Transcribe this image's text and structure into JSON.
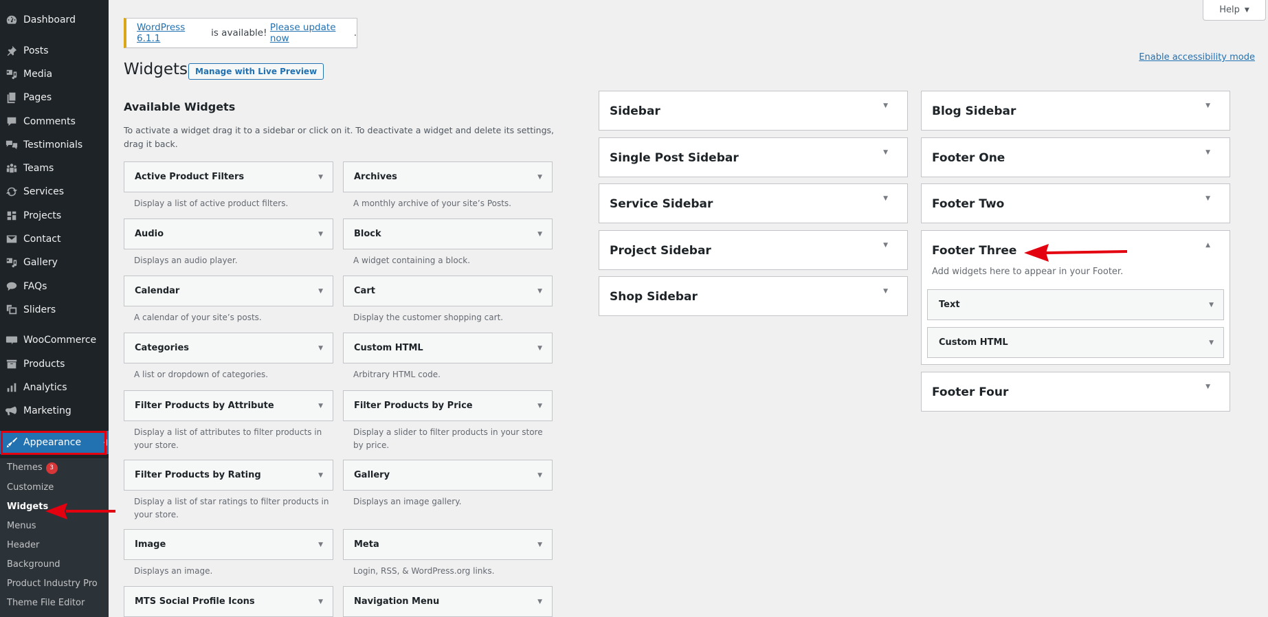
{
  "sidebar": {
    "items": [
      {
        "label": "Dashboard",
        "icon": "dashboard-icon"
      },
      {
        "label": "Posts",
        "icon": "pin-icon"
      },
      {
        "label": "Media",
        "icon": "media-icon"
      },
      {
        "label": "Pages",
        "icon": "pages-icon"
      },
      {
        "label": "Comments",
        "icon": "comment-icon"
      },
      {
        "label": "Testimonials",
        "icon": "testimonial-icon"
      },
      {
        "label": "Teams",
        "icon": "groups-icon"
      },
      {
        "label": "Services",
        "icon": "update-icon"
      },
      {
        "label": "Projects",
        "icon": "portfolio-icon"
      },
      {
        "label": "Contact",
        "icon": "email-icon"
      },
      {
        "label": "Gallery",
        "icon": "gallery-icon"
      },
      {
        "label": "FAQs",
        "icon": "faq-icon"
      },
      {
        "label": "Sliders",
        "icon": "slides-icon"
      },
      {
        "label": "WooCommerce",
        "icon": "woo-icon"
      },
      {
        "label": "Products",
        "icon": "archive-icon"
      },
      {
        "label": "Analytics",
        "icon": "chart-icon"
      },
      {
        "label": "Marketing",
        "icon": "megaphone-icon"
      },
      {
        "label": "Appearance",
        "icon": "brush-icon"
      }
    ],
    "submenu": [
      {
        "label": "Themes",
        "badge": "3"
      },
      {
        "label": "Customize"
      },
      {
        "label": "Widgets"
      },
      {
        "label": "Menus"
      },
      {
        "label": "Header"
      },
      {
        "label": "Background"
      },
      {
        "label": "Product Industry Pro"
      },
      {
        "label": "Theme File Editor"
      }
    ]
  },
  "header": {
    "help_label": "Help",
    "notice": {
      "link1": "WordPress 6.1.1",
      "middle": " is available! ",
      "link2": "Please update now",
      "end": "."
    },
    "title": "Widgets",
    "live_preview_label": "Manage with Live Preview",
    "accessibility_link": "Enable accessibility mode"
  },
  "available": {
    "title": "Available Widgets",
    "description": "To activate a widget drag it to a sidebar or click on it. To deactivate a widget and delete its settings, drag it back.",
    "widgets": [
      {
        "title": "Active Product Filters",
        "desc": "Display a list of active product filters."
      },
      {
        "title": "Archives",
        "desc": "A monthly archive of your site’s Posts."
      },
      {
        "title": "Audio",
        "desc": "Displays an audio player."
      },
      {
        "title": "Block",
        "desc": "A widget containing a block."
      },
      {
        "title": "Calendar",
        "desc": "A calendar of your site’s posts."
      },
      {
        "title": "Cart",
        "desc": "Display the customer shopping cart."
      },
      {
        "title": "Categories",
        "desc": "A list or dropdown of categories."
      },
      {
        "title": "Custom HTML",
        "desc": "Arbitrary HTML code."
      },
      {
        "title": "Filter Products by Attribute",
        "desc": "Display a list of attributes to filter products in your store."
      },
      {
        "title": "Filter Products by Price",
        "desc": "Display a slider to filter products in your store by price."
      },
      {
        "title": "Filter Products by Rating",
        "desc": "Display a list of star ratings to filter products in your store."
      },
      {
        "title": "Gallery",
        "desc": "Displays an image gallery."
      },
      {
        "title": "Image",
        "desc": "Displays an image."
      },
      {
        "title": "Meta",
        "desc": "Login, RSS, & WordPress.org links."
      },
      {
        "title": "MTS Social Profile Icons",
        "desc": ""
      },
      {
        "title": "Navigation Menu",
        "desc": ""
      }
    ]
  },
  "sidebars": {
    "left": [
      "Sidebar",
      "Single Post Sidebar",
      "Service Sidebar",
      "Project Sidebar",
      "Shop Sidebar"
    ],
    "right": [
      "Blog Sidebar",
      "Footer One",
      "Footer Two",
      "Footer Three",
      "Footer Four"
    ],
    "open": {
      "name": "Footer Three",
      "description": "Add widgets here to appear in your Footer.",
      "widgets": [
        "Text",
        "Custom HTML"
      ]
    }
  },
  "colors": {
    "accent": "#2271b1",
    "sidebar_bg": "#1d2327",
    "annotation_red": "#e3000f",
    "notice_warning": "#dba617",
    "badge": "#d63638"
  }
}
